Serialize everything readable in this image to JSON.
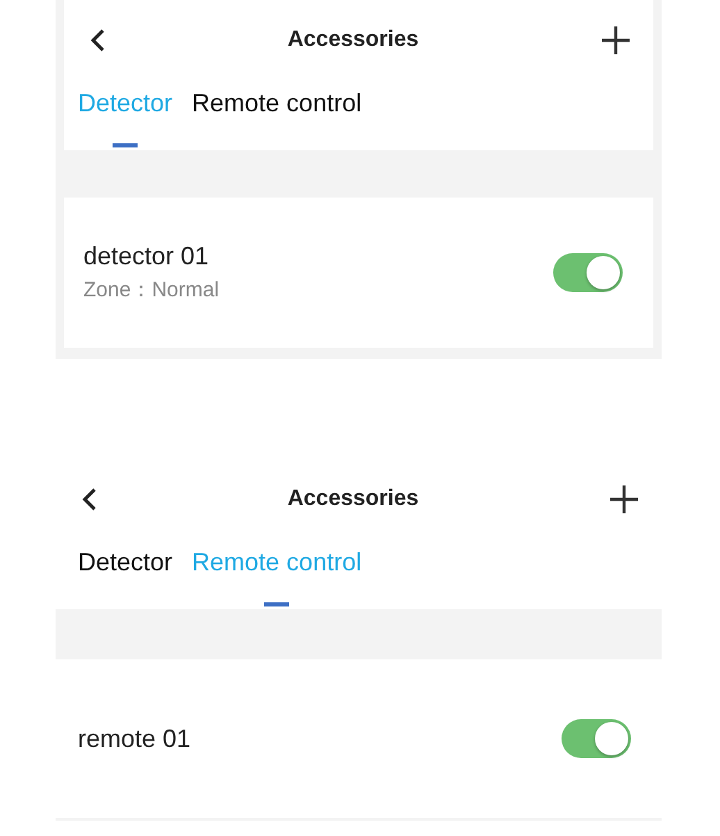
{
  "screens": [
    {
      "title": "Accessories",
      "tabs": [
        {
          "label": "Detector",
          "selected": true
        },
        {
          "label": "Remote control",
          "selected": false
        }
      ],
      "items": [
        {
          "name": "detector 01",
          "zone": "Zone：Normal",
          "on": true
        }
      ]
    },
    {
      "title": "Accessories",
      "tabs": [
        {
          "label": "Detector",
          "selected": false
        },
        {
          "label": "Remote control",
          "selected": true
        }
      ],
      "items": [
        {
          "name": "remote 01",
          "on": true
        }
      ]
    }
  ]
}
